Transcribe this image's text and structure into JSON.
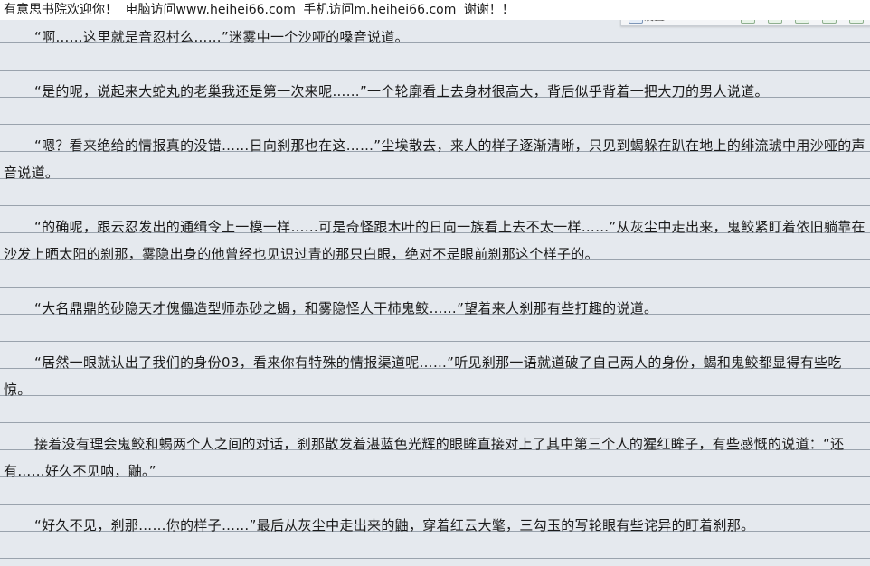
{
  "header": {
    "welcome": "有意思书院欢迎你！",
    "pc_visit": "电脑访问www.heihei66.com",
    "mobile_visit": "手机访问m.heihei66.com",
    "thanks": "谢谢！！"
  },
  "toolbar": {
    "label": "设置"
  },
  "paragraphs": [
    "“啊……这里就是音忍村么……”迷雾中一个沙哑的嗓音说道。",
    "“是的呢，说起来大蛇丸的老巢我还是第一次来呢……”一个轮廓看上去身材很高大，背后似乎背着一把大刀的男人说道。",
    "“嗯？看来绝给的情报真的没错……日向刹那也在这……”尘埃散去，来人的样子逐渐清晰，只见到蝎躲在趴在地上的绯流琥中用沙哑的声音说道。",
    "“的确呢，跟云忍发出的通缉令上一模一样……可是奇怪跟木叶的日向一族看上去不太一样……”从灰尘中走出来，鬼鲛紧盯着依旧躺靠在沙发上晒太阳的刹那，雾隐出身的他曾经也见识过青的那只白眼，绝对不是眼前刹那这个样子的。",
    "“大名鼎鼎的砂隐天才傀儡造型师赤砂之蝎，和雾隐怪人干柿鬼鲛……”望着来人刹那有些打趣的说道。",
    "“居然一眼就认出了我们的身份03，看来你有特殊的情报渠道呢……”听见刹那一语就道破了自己两人的身份，蝎和鬼鲛都显得有些吃惊。",
    "接着没有理会鬼鲛和蝎两个人之间的对话，刹那散发着湛蓝色光辉的眼眸直接对上了其中第三个人的猩红眸子，有些感慨的说道：“还有……好久不见呐，鼬。”",
    "“好久不见，刹那……你的样子……”最后从灰尘中走出来的鼬，穿着红云大氅，三勾玉的写轮眼有些诧异的盯着刹那。"
  ]
}
